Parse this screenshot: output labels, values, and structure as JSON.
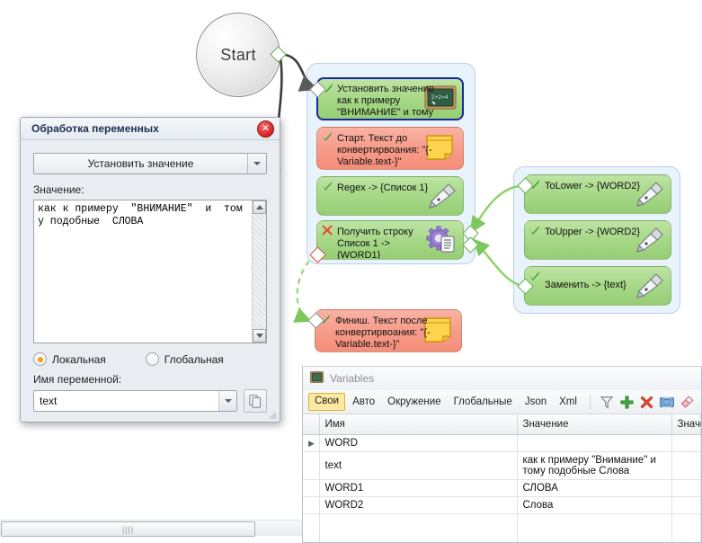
{
  "canvas": {
    "start_node": {
      "label": "Start"
    },
    "groups": [
      {
        "name": "left-group"
      },
      {
        "name": "right-group"
      }
    ],
    "nodes": [
      {
        "id": "set-value",
        "text": "Установить значение как к примеру \"ВНИМАНИЕ\" и тому п",
        "status": "ok",
        "color": "green",
        "icon": "blackboard-icon",
        "selected": true
      },
      {
        "id": "start-text",
        "text": "Старт. Текст до конвертирвоания: \"{-Variable.text-}\"",
        "status": "ok",
        "color": "red",
        "icon": "note-icon",
        "selected": false
      },
      {
        "id": "regex",
        "text": "Regex -> {Список 1}",
        "status": "ok",
        "color": "green",
        "icon": "pen-icon",
        "selected": false
      },
      {
        "id": "get-string",
        "text": "Получить строку Список 1 -> {WORD1}",
        "status": "error",
        "color": "green",
        "icon": "gear-doc-icon",
        "selected": false
      },
      {
        "id": "tolower",
        "text": "ToLower -> {WORD2}",
        "status": "ok",
        "color": "green",
        "icon": "pen-icon",
        "selected": false
      },
      {
        "id": "toupper",
        "text": "ToUpper -> {WORD2}",
        "status": "ok",
        "color": "green",
        "icon": "pen-icon",
        "selected": false
      },
      {
        "id": "replace",
        "text": "Заменить -> {text}",
        "status": "ok",
        "color": "green",
        "icon": "pen-icon",
        "selected": false
      },
      {
        "id": "finish-text",
        "text": "Финиш. Текст после конвертирвоания: \"{-Variable.text-}\"",
        "status": "ok",
        "color": "red",
        "icon": "note-icon",
        "selected": false
      }
    ]
  },
  "dialog": {
    "title": "Обработка переменных",
    "close_label": "✕",
    "action_combo": {
      "value": "Установить значение"
    },
    "value_label": "Значение:",
    "value_text": "как к примеру  \"ВНИМАНИЕ\"  и  тому подобные  СЛОВА",
    "scope": {
      "local_label": "Локальная",
      "global_label": "Глобальная",
      "selected": "local"
    },
    "varname_label": "Имя переменной:",
    "varname_value": "text"
  },
  "variables_panel": {
    "title": "Variables",
    "title_icon": "blackboard-icon",
    "tabs": [
      {
        "label": "Свои",
        "active": true
      },
      {
        "label": "Авто",
        "active": false
      },
      {
        "label": "Окружение",
        "active": false
      },
      {
        "label": "Глобальные",
        "active": false
      },
      {
        "label": "Json",
        "active": false
      },
      {
        "label": "Xml",
        "active": false
      }
    ],
    "tools": [
      {
        "name": "filter-icon"
      },
      {
        "name": "add-icon"
      },
      {
        "name": "delete-icon"
      },
      {
        "name": "rename-icon"
      },
      {
        "name": "eraser-icon"
      }
    ],
    "columns": [
      "",
      "Имя",
      "Значение",
      "Значе"
    ],
    "rows": [
      {
        "selected": true,
        "name": "WORD",
        "value": "",
        "value2": "",
        "highlight": true
      },
      {
        "selected": false,
        "name": "text",
        "value": "как к примеру \"Внимание\" и тому подобные Слова",
        "value2": "",
        "highlight": false
      },
      {
        "selected": false,
        "name": "WORD1",
        "value": "СЛОВА",
        "value2": "",
        "highlight": false
      },
      {
        "selected": false,
        "name": "WORD2",
        "value": "Слова",
        "value2": "",
        "highlight": false
      }
    ]
  },
  "bottom_scrollbar": {
    "grip": "||||"
  },
  "colors": {
    "node_green": "#a8d98a",
    "node_red": "#f79e8c",
    "group_blue": "#e8f3fb",
    "selection_border": "#15299b",
    "link_green": "#8ed26a",
    "link_dark": "#3b3b3b",
    "highlight_cell": "#fdfbc8",
    "tab_active": "#fde9a0"
  }
}
